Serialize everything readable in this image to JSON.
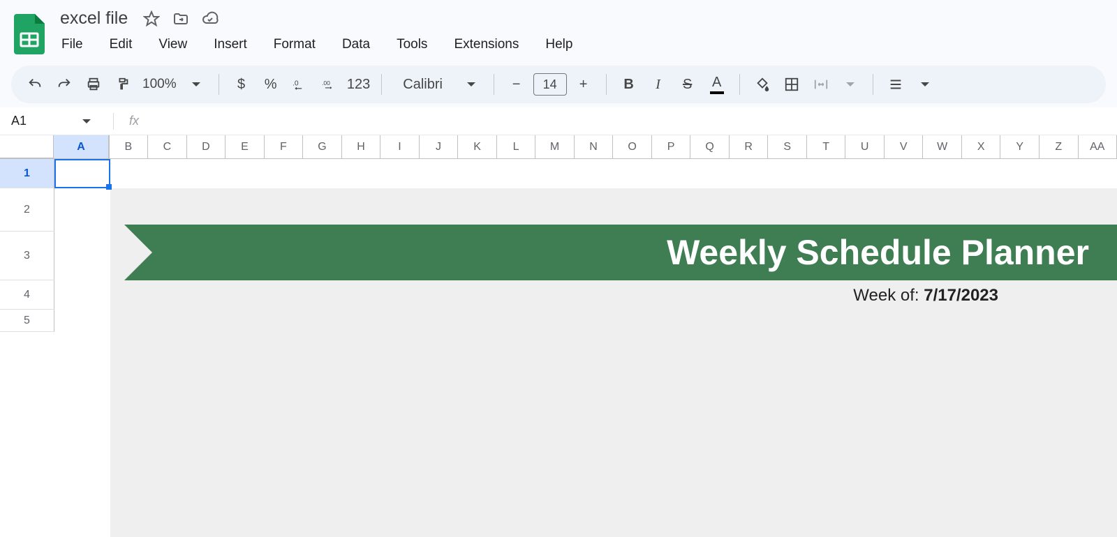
{
  "doc": {
    "title": "excel file"
  },
  "menus": [
    "File",
    "Edit",
    "View",
    "Insert",
    "Format",
    "Data",
    "Tools",
    "Extensions",
    "Help"
  ],
  "toolbar": {
    "zoom": "100%",
    "format_auto": "123",
    "font_name": "Calibri",
    "font_size": "14",
    "currency": "$",
    "percent": "%",
    "dec_less": ".0",
    "dec_more": ".00",
    "minus": "−",
    "plus": "+",
    "bold": "B",
    "italic": "I",
    "strike": "S",
    "text_color": "A"
  },
  "namebox": {
    "cell": "A1",
    "fx": "fx"
  },
  "columns": [
    "A",
    "B",
    "C",
    "D",
    "E",
    "F",
    "G",
    "H",
    "I",
    "J",
    "K",
    "L",
    "M",
    "N",
    "O",
    "P",
    "Q",
    "R",
    "S",
    "T",
    "U",
    "V",
    "W",
    "X",
    "Y",
    "Z",
    "AA"
  ],
  "rows": [
    "1",
    "2",
    "3",
    "4",
    "5"
  ],
  "content": {
    "banner_title": "Weekly Schedule Planner",
    "week_of_label": "Week of: ",
    "week_of_date": "7/17/2023"
  },
  "chart_data": null
}
